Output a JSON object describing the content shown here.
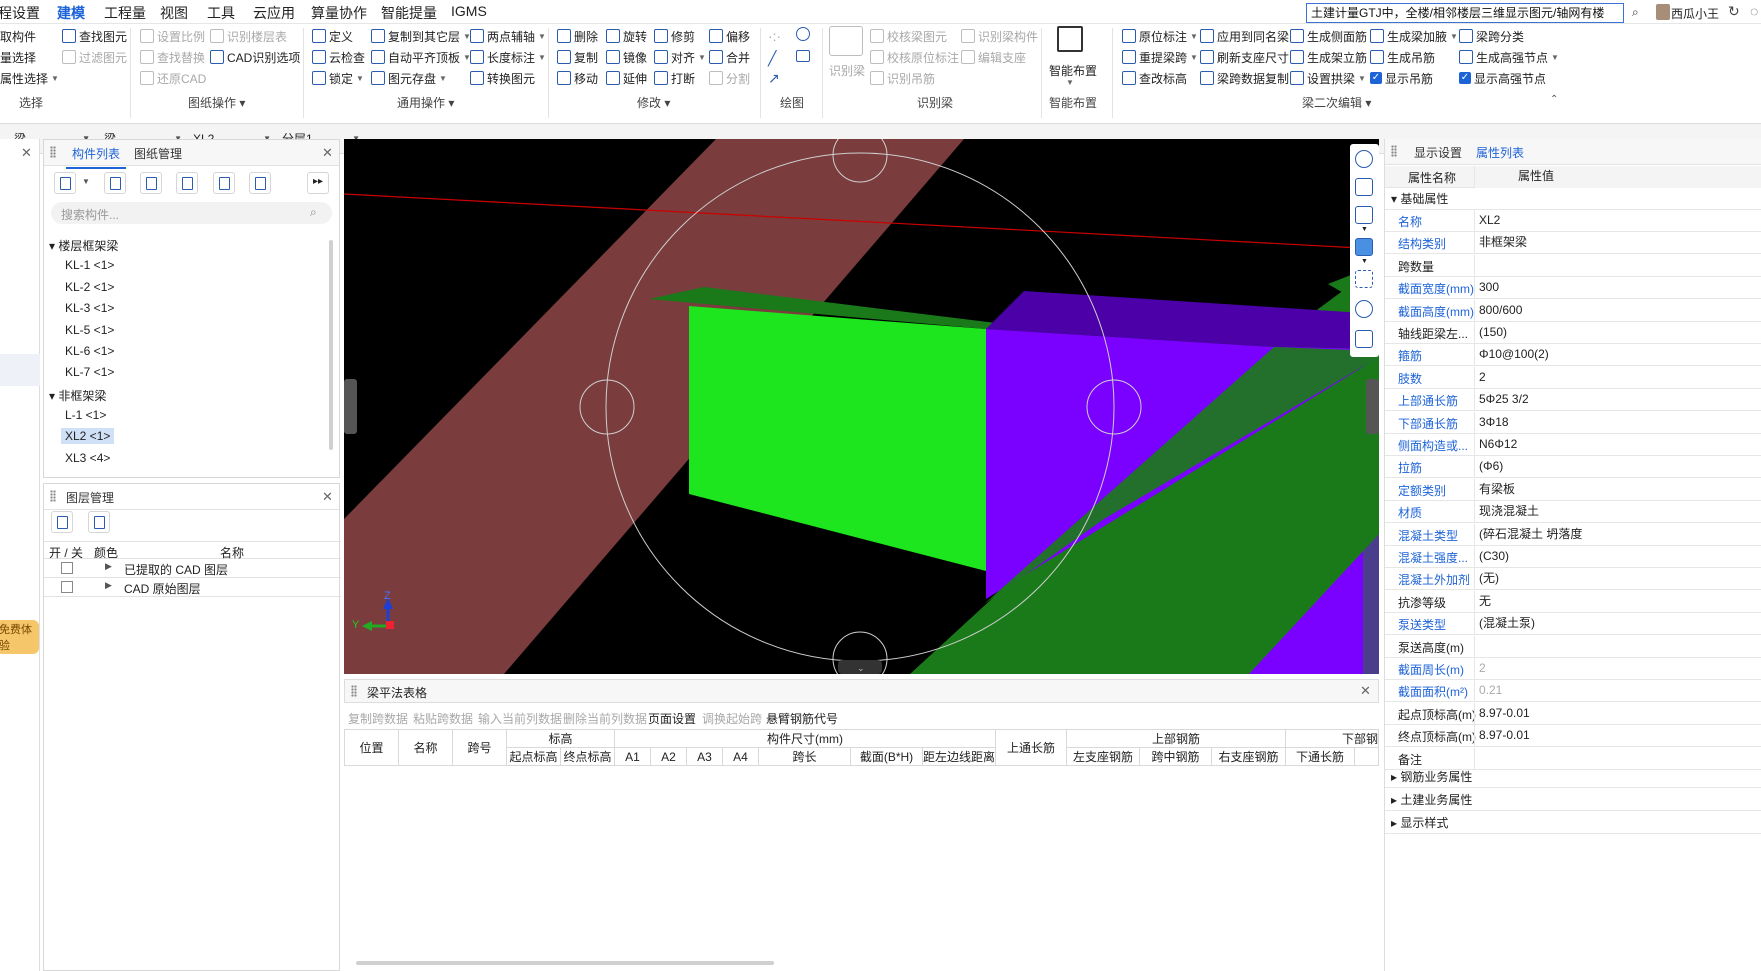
{
  "menubar": {
    "items": [
      "程设置",
      "建模",
      "工程量",
      "视图",
      "工具",
      "云应用",
      "算量协作",
      "智能提量",
      "IGMS"
    ],
    "active": "建模",
    "search_text": "土建计量GTJ中，全楼/相邻楼层三维显示图元/轴网有楼",
    "user_name": "西瓜小王"
  },
  "ribbon": {
    "sel": {
      "items": [
        "取构件",
        "量选择",
        "属性选择"
      ],
      "group": "选择"
    },
    "paper": {
      "items": [
        "查找图元",
        "过滤图元",
        "设置比例",
        "查找替换",
        "还原CAD",
        "识别楼层表",
        "CAD识别选项"
      ],
      "group": "图纸操作"
    },
    "common": {
      "items": [
        "定义",
        "云检查",
        "锁定",
        "复制到其它层",
        "自动平齐顶板",
        "图元存盘",
        "两点辅轴",
        "长度标注",
        "转换图元"
      ],
      "group": "通用操作"
    },
    "modify": {
      "items": [
        "删除",
        "复制",
        "移动",
        "旋转",
        "镜像",
        "延伸",
        "修剪",
        "对齐",
        "打断",
        "偏移",
        "合并",
        "分割"
      ],
      "group": "修改"
    },
    "draw": {
      "group": "绘图"
    },
    "recognize": {
      "items": [
        "识别梁",
        "校核梁图元",
        "校核原位标注",
        "识别吊筋",
        "识别梁构件",
        "编辑支座"
      ],
      "group": "识别梁"
    },
    "smart": {
      "label": "智能布置",
      "group": "智能布置"
    },
    "beam2": {
      "items": [
        "原位标注",
        "重提梁跨",
        "查改标高",
        "应用到同名梁",
        "刷新支座尺寸",
        "梁跨数据复制",
        "生成侧面筋",
        "生成架立筋",
        "设置拱梁",
        "生成梁加腋",
        "生成吊筋",
        "显示吊筋",
        "梁跨分类",
        "生成高强节点",
        "显示高强节点"
      ],
      "group": "梁二次编辑"
    }
  },
  "filterbar": {
    "f1": "",
    "f2": "梁",
    "f3": "梁",
    "f4": "XL2",
    "f5": "分层1"
  },
  "left_edge_badge": "免费体验",
  "component_panel": {
    "tabs": [
      "构件列表",
      "图纸管理"
    ],
    "search_placeholder": "搜索构件...",
    "group1": "楼层框架梁",
    "group1_items": [
      "KL-1 <1>",
      "KL-2 <1>",
      "KL-3 <1>",
      "KL-5 <1>",
      "KL-6 <1>",
      "KL-7 <1>"
    ],
    "group2": "非框架梁",
    "group2_items": [
      "L-1 <1>",
      "XL2 <1>",
      "XL3 <4>"
    ],
    "selected": "XL2 <1>"
  },
  "layer_panel": {
    "title": "图层管理",
    "col_toggle": "开 / 关",
    "col_color": "颜色",
    "col_name": "名称",
    "rows": [
      "已提取的 CAD 图层",
      "CAD 原始图层"
    ]
  },
  "viewport": {
    "axis_y": "Y",
    "axis_z": "Z",
    "colors": {
      "background": "#000000",
      "column": "#7a3c3c",
      "beam_green": "#1ee61e",
      "beam_purple": "#7a00ff",
      "slab_green": "#1a7a1a",
      "guide_line": "#cc0000"
    }
  },
  "beam_table": {
    "title": "梁平法表格",
    "toolbar": [
      "复制跨数据",
      "粘贴跨数据",
      "输入当前列数据",
      "删除当前列数据",
      "页面设置",
      "调换起始跨",
      "悬臂钢筋代号"
    ],
    "h_pos": "位置",
    "h_name": "名称",
    "h_span": "跨号",
    "h_elev": "标高",
    "h_start": "起点标高",
    "h_end": "终点标高",
    "h_dim": "构件尺寸(mm)",
    "h_a1": "A1",
    "h_a2": "A2",
    "h_a3": "A3",
    "h_a4": "A4",
    "h_spanlen": "跨长",
    "h_section": "截面(B*H)",
    "h_dist": "距左边线距离",
    "h_top_long": "上通长筋",
    "h_top_rebar": "上部钢筋",
    "h_left_sup": "左支座钢筋",
    "h_mid": "跨中钢筋",
    "h_right_sup": "右支座钢筋",
    "h_bottom": "下部钢",
    "h_bot_long": "下通长筋"
  },
  "props": {
    "tabs": [
      "显示设置",
      "属性列表"
    ],
    "col_name": "属性名称",
    "col_value": "属性值",
    "section": "基础属性",
    "rows": [
      {
        "name": "名称",
        "value": "XL2",
        "blue": true
      },
      {
        "name": "结构类别",
        "value": "非框架梁",
        "blue": true
      },
      {
        "name": "跨数量",
        "value": "",
        "blue": false
      },
      {
        "name": "截面宽度(mm)",
        "value": "300",
        "blue": true
      },
      {
        "name": "截面高度(mm)",
        "value": "800/600",
        "blue": true
      },
      {
        "name": "轴线距梁左...",
        "value": "(150)",
        "blue": false
      },
      {
        "name": "箍筋",
        "value": "Φ10@100(2)",
        "blue": true
      },
      {
        "name": "肢数",
        "value": "2",
        "blue": true
      },
      {
        "name": "上部通长筋",
        "value": "5Φ25 3/2",
        "blue": true
      },
      {
        "name": "下部通长筋",
        "value": "3Φ18",
        "blue": true
      },
      {
        "name": "侧面构造或...",
        "value": "N6Φ12",
        "blue": true
      },
      {
        "name": "拉筋",
        "value": "(Φ6)",
        "blue": true
      },
      {
        "name": "定额类别",
        "value": "有梁板",
        "blue": true
      },
      {
        "name": "材质",
        "value": "现浇混凝土",
        "blue": true
      },
      {
        "name": "混凝土类型",
        "value": "(碎石混凝土 坍落度",
        "blue": true
      },
      {
        "name": "混凝土强度...",
        "value": "(C30)",
        "blue": true
      },
      {
        "name": "混凝土外加剂",
        "value": "(无)",
        "blue": true
      },
      {
        "name": "抗渗等级",
        "value": "无",
        "blue": false
      },
      {
        "name": "泵送类型",
        "value": "(混凝土泵)",
        "blue": true
      },
      {
        "name": "泵送高度(m)",
        "value": "",
        "blue": false
      },
      {
        "name": "截面周长(m)",
        "value": "2",
        "blue": true,
        "gray": true
      },
      {
        "name": "截面面积(m²)",
        "value": "0.21",
        "blue": true,
        "gray": true
      },
      {
        "name": "起点顶标高(m)",
        "value": "8.97-0.01",
        "blue": false
      },
      {
        "name": "终点顶标高(m)",
        "value": "8.97-0.01",
        "blue": false
      },
      {
        "name": "备注",
        "value": "",
        "blue": false
      }
    ],
    "sections_collapsed": [
      "钢筋业务属性",
      "土建业务属性",
      "显示样式"
    ]
  }
}
